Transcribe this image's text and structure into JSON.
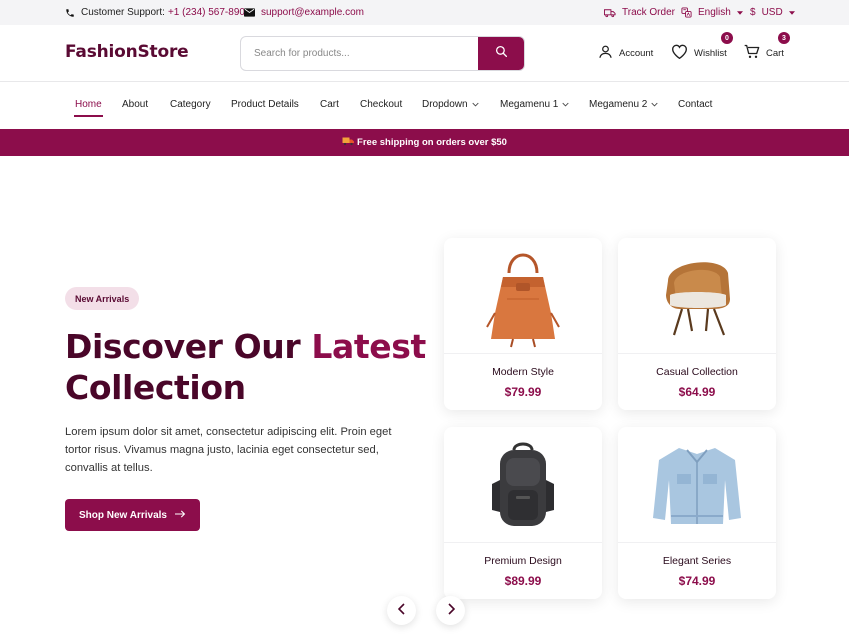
{
  "topbar": {
    "support_label": "Customer Support:",
    "support_phone": "+1 (234) 567-890",
    "email": "support@example.com",
    "track_order": "Track Order",
    "language": "English",
    "currency": "USD",
    "currency_symbol": "$"
  },
  "header": {
    "logo": "FashionStore",
    "search_placeholder": "Search for products...",
    "account_label": "Account",
    "wishlist_label": "Wishlist",
    "wishlist_count": "0",
    "cart_label": "Cart",
    "cart_count": "3"
  },
  "nav": {
    "items": [
      {
        "label": "Home",
        "active": true
      },
      {
        "label": "About"
      },
      {
        "label": "Category"
      },
      {
        "label": "Product Details"
      },
      {
        "label": "Cart"
      },
      {
        "label": "Checkout"
      },
      {
        "label": "Dropdown",
        "has_dropdown": true
      },
      {
        "label": "Megamenu 1",
        "has_dropdown": true
      },
      {
        "label": "Megamenu 2",
        "has_dropdown": true
      },
      {
        "label": "Contact"
      }
    ]
  },
  "banner": {
    "text": "Free shipping on orders over $50",
    "icon": "truck-icon"
  },
  "hero": {
    "badge": "New Arrivals",
    "title_part1": "Discover Our ",
    "title_highlight": "Latest",
    "title_part2": "Collection",
    "description": "Lorem ipsum dolor sit amet, consectetur adipiscing elit. Proin eget tortor risus. Vivamus magna justo, lacinia eget consectetur sed, convallis at tellus.",
    "cta_label": "Shop New Arrivals"
  },
  "products": [
    {
      "name": "Modern Style",
      "price": "$79.99",
      "image": "handbag"
    },
    {
      "name": "Casual Collection",
      "price": "$64.99",
      "image": "chair"
    },
    {
      "name": "Premium Design",
      "price": "$89.99",
      "image": "backpack"
    },
    {
      "name": "Elegant Series",
      "price": "$74.99",
      "image": "denim-jacket"
    }
  ],
  "colors": {
    "brand": "#8c0d4b",
    "brand_dark": "#4a0629",
    "pill_bg": "#f3dfe8",
    "topbar_bg": "#f4f4f6"
  }
}
